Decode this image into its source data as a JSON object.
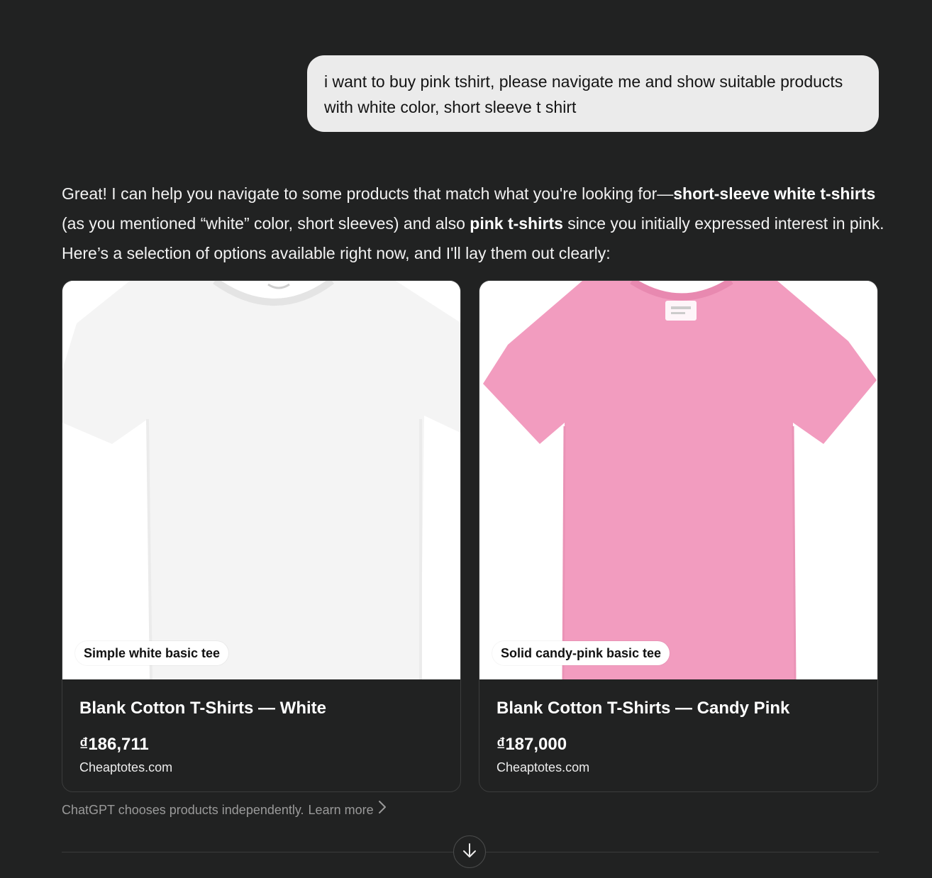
{
  "user_message": {
    "text": "i want to buy pink tshirt, please navigate me and show suitable products with white color, short sleeve t shirt"
  },
  "assistant_message": {
    "part1": "Great! I can help you navigate to some products that match what you're looking for—",
    "bold1": "short-sleeve white t-shirts",
    "part2": " (as you mentioned “white” color, short sleeves) and also ",
    "bold2": "pink t-shirts",
    "part3": " since you initially expressed interest in pink. Here’s a selection of options available right now, and I'll lay them out clearly:"
  },
  "products": [
    {
      "tag": "Simple white basic tee",
      "title": "Blank Cotton T-Shirts — White",
      "price": "₫186,711",
      "merchant": "Cheaptotes.com",
      "shirt_color": "#f4f4f4",
      "icon": "white-tshirt-image"
    },
    {
      "tag": "Solid candy-pink basic tee",
      "title": "Blank Cotton T-Shirts — Candy Pink",
      "price": "₫187,000",
      "merchant": "Cheaptotes.com",
      "shirt_color": "#f29cbf",
      "icon": "pink-tshirt-image"
    }
  ],
  "footer": {
    "disclaimer": "ChatGPT chooses products independently.",
    "learn_more": "Learn more",
    "chevron_icon": "chevron-right-icon",
    "scroll_icon": "arrow-down-icon"
  }
}
